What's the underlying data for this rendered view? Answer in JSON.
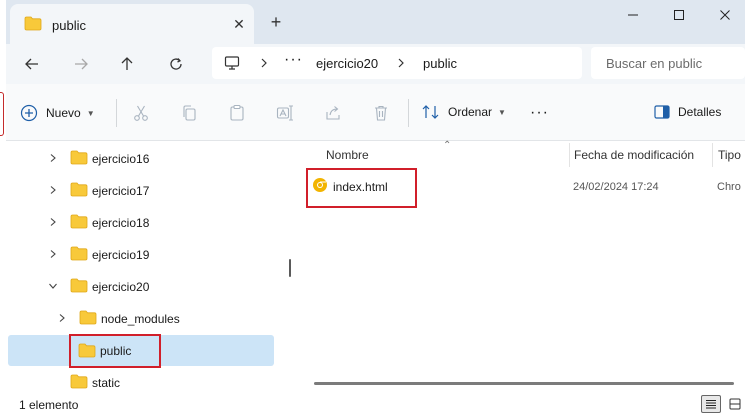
{
  "window": {
    "tab_title": "public",
    "new_tab_glyph": "+",
    "close_glyph": "✕"
  },
  "address": {
    "breadcrumb": [
      "ejercicio20",
      "public"
    ],
    "overflow_glyph": "···",
    "search_placeholder": "Buscar en public"
  },
  "toolbar": {
    "new_label": "Nuevo",
    "sort_label": "Ordenar",
    "more_glyph": "···",
    "details_label": "Detalles",
    "icons": [
      "cut-icon",
      "copy-icon",
      "paste-icon",
      "rename-icon",
      "share-icon",
      "delete-icon"
    ]
  },
  "tree": [
    {
      "label": "ejercicio16",
      "expanded": false,
      "level": 0
    },
    {
      "label": "ejercicio17",
      "expanded": false,
      "level": 0
    },
    {
      "label": "ejercicio18",
      "expanded": false,
      "level": 0
    },
    {
      "label": "ejercicio19",
      "expanded": false,
      "level": 0
    },
    {
      "label": "ejercicio20",
      "expanded": true,
      "level": 0
    },
    {
      "label": "node_modules",
      "expanded": false,
      "level": 1
    },
    {
      "label": "public",
      "selected": true,
      "level": 1
    },
    {
      "label": "static",
      "level": 0
    }
  ],
  "filelist": {
    "columns": [
      "Nombre",
      "Fecha de modificación",
      "Tipo"
    ],
    "rows": [
      {
        "name": "index.html",
        "date": "24/02/2024 17:24",
        "type": "Chro"
      }
    ]
  },
  "status": {
    "item_count": "1 elemento"
  },
  "colors": {
    "folder": "#f8c93a",
    "folder_dark": "#e6a918",
    "selection": "#cce4f7",
    "highlight_box": "#d11f2a",
    "chrome_icon": "#f2b400"
  }
}
